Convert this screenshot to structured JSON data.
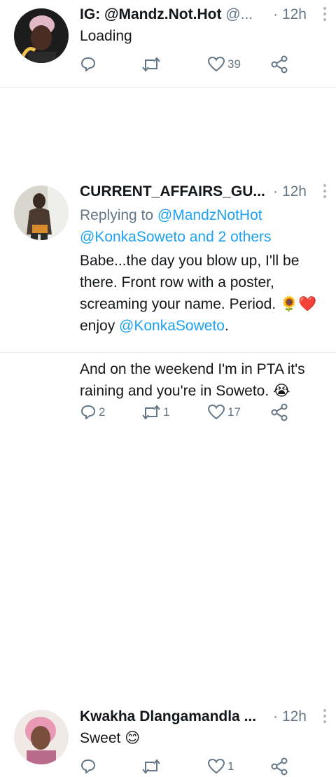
{
  "tweets": [
    {
      "display_name": "IG: @Mandz.Not.Hot",
      "handle": "@...",
      "time": "· 12h",
      "text": "Loading",
      "replies": "",
      "retweets": "",
      "likes": "39"
    },
    {
      "display_name": "CURRENT_AFFAIRS_GU...",
      "time": "· 12h",
      "replying_prefix": "Replying to ",
      "replying_to": "@MandzNotHot",
      "replying_more": "@KonkaSoweto and 2 others",
      "line1": "Babe...the day you blow up, I'll be",
      "line2": "there. Front row with a poster,",
      "line3": "screaming your name. Period. 🌻❤️",
      "line4_prefix": "enjoy ",
      "line4_mention": "@KonkaSoweto",
      "line4_suffix": ".",
      "line5": "And on the weekend I'm in PTA it's",
      "line6": "raining and you're in Soweto. 😭",
      "replies": "2",
      "retweets": "1",
      "likes": "17"
    },
    {
      "display_name": "Kwakha Dlangamandla ...",
      "time": "· 12h",
      "text": "Sweet 😊",
      "replies": "",
      "retweets": "",
      "likes": "1"
    }
  ],
  "icons": {
    "reply": "reply-icon",
    "retweet": "retweet-icon",
    "like": "heart-icon",
    "share": "share-icon",
    "more": "more-icon"
  },
  "colors": {
    "link": "#1da1f2",
    "muted": "#657786",
    "text": "#14171a",
    "divider": "#e6ecf0"
  }
}
